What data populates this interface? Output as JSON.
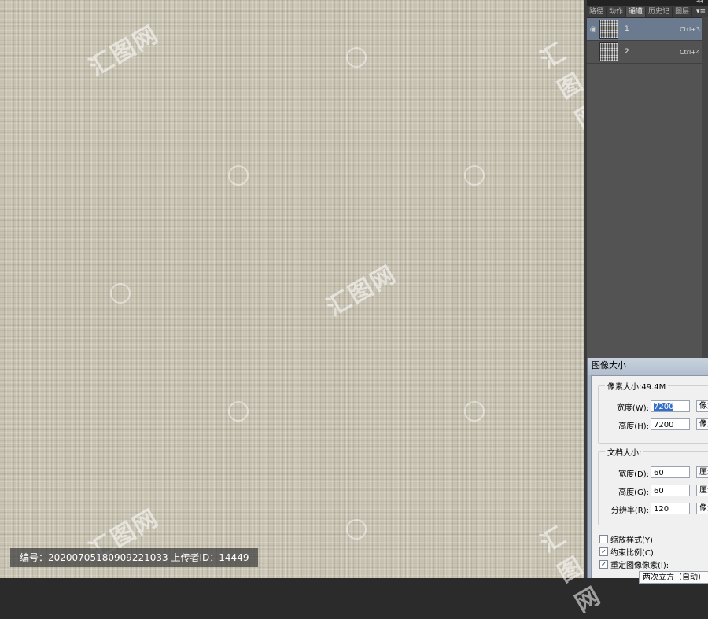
{
  "canvas": {
    "caption": "编号：20200705180909221033 上传者ID：14449",
    "watermark": "汇图网"
  },
  "panel": {
    "tabs": [
      "路径",
      "动作",
      "通道",
      "历史记",
      "图层"
    ],
    "active_tab": 2,
    "channels": [
      {
        "name": "1",
        "shortcut": "Ctrl+3",
        "selected": true
      },
      {
        "name": "2",
        "shortcut": "Ctrl+4",
        "selected": false
      }
    ]
  },
  "dialog": {
    "title": "图像大小",
    "pixel_dimensions": {
      "label": "像素大小:49.4M",
      "width_label": "宽度(W):",
      "width_value": "7200",
      "width_unit": "像素",
      "height_label": "高度(H):",
      "height_value": "7200",
      "height_unit": "像素"
    },
    "document_size": {
      "label": "文档大小:",
      "width_label": "宽度(D):",
      "width_value": "60",
      "width_unit": "厘米",
      "height_label": "高度(G):",
      "height_value": "60",
      "height_unit": "厘米",
      "resolution_label": "分辨率(R):",
      "resolution_value": "120",
      "resolution_unit": "像素"
    },
    "options": {
      "scale_styles": {
        "label": "缩放样式(Y)",
        "checked": false
      },
      "constrain": {
        "label": "约束比例(C)",
        "checked": true
      },
      "resample": {
        "label": "重定图像像素(I):",
        "checked": true
      },
      "resample_method": "两次立方（自动）"
    }
  }
}
